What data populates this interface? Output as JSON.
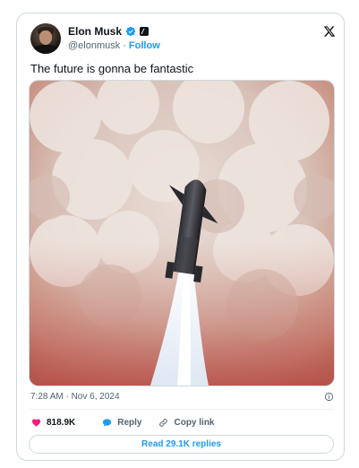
{
  "author": {
    "name": "Elon Musk",
    "handle": "@elonmusk",
    "separator": "·",
    "follow_label": "Follow"
  },
  "tweet": {
    "text": "The future is gonna be fantastic",
    "timestamp": "7:28 AM · Nov 6, 2024"
  },
  "actions": {
    "likes": "818.9K",
    "reply_label": "Reply",
    "copy_link_label": "Copy link"
  },
  "read_replies_label": "Read 29.1K replies",
  "colors": {
    "accent": "#1d9bf0",
    "like": "#f91880",
    "text": "#0f1419",
    "secondary": "#536471",
    "border": "#cfd9de"
  },
  "icons": {
    "verified": "verified-badge-icon",
    "affiliate": "x-affiliate-badge-icon",
    "brand": "x-logo-icon",
    "info": "info-icon",
    "like": "heart-icon",
    "reply": "speech-bubble-icon",
    "copy_link": "link-icon"
  }
}
